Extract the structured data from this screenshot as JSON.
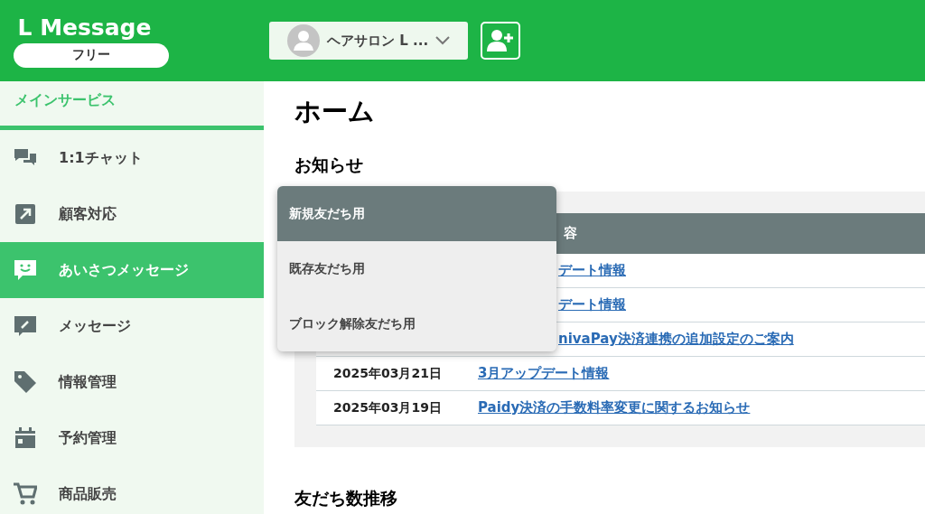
{
  "header": {
    "logo": "L Message",
    "plan": "フリー",
    "account": {
      "name": "ヘアサロン L ..."
    }
  },
  "sidebar": {
    "section": "メインサービス",
    "items": [
      {
        "label": "1:1チャット",
        "selected": false
      },
      {
        "label": "顧客対応",
        "selected": false
      },
      {
        "label": "あいさつメッセージ",
        "selected": true
      },
      {
        "label": "メッセージ",
        "selected": false
      },
      {
        "label": "情報管理",
        "selected": false
      },
      {
        "label": "予約管理",
        "selected": false
      },
      {
        "label": "商品販売",
        "selected": false
      }
    ]
  },
  "main": {
    "title": "ホーム",
    "notices": {
      "title": "お知らせ",
      "column_2": "容",
      "rows": [
        {
          "link": "デート情報"
        },
        {
          "link": "デート情報"
        },
        {
          "link": "nivaPay決済連携の追加設定のご案内"
        },
        {
          "date": "2025年03月21日",
          "link": "3月アップデート情報"
        },
        {
          "date": "2025年03月19日",
          "link": "Paidy決済の手数料率変更に関するお知らせ"
        }
      ]
    },
    "friends_title": "友だち数推移"
  },
  "menu": [
    {
      "label": "新規友だち用",
      "selected": true
    },
    {
      "label": "既存友だち用",
      "selected": false
    },
    {
      "label": "ブロック解除友だち用",
      "selected": false
    }
  ]
}
